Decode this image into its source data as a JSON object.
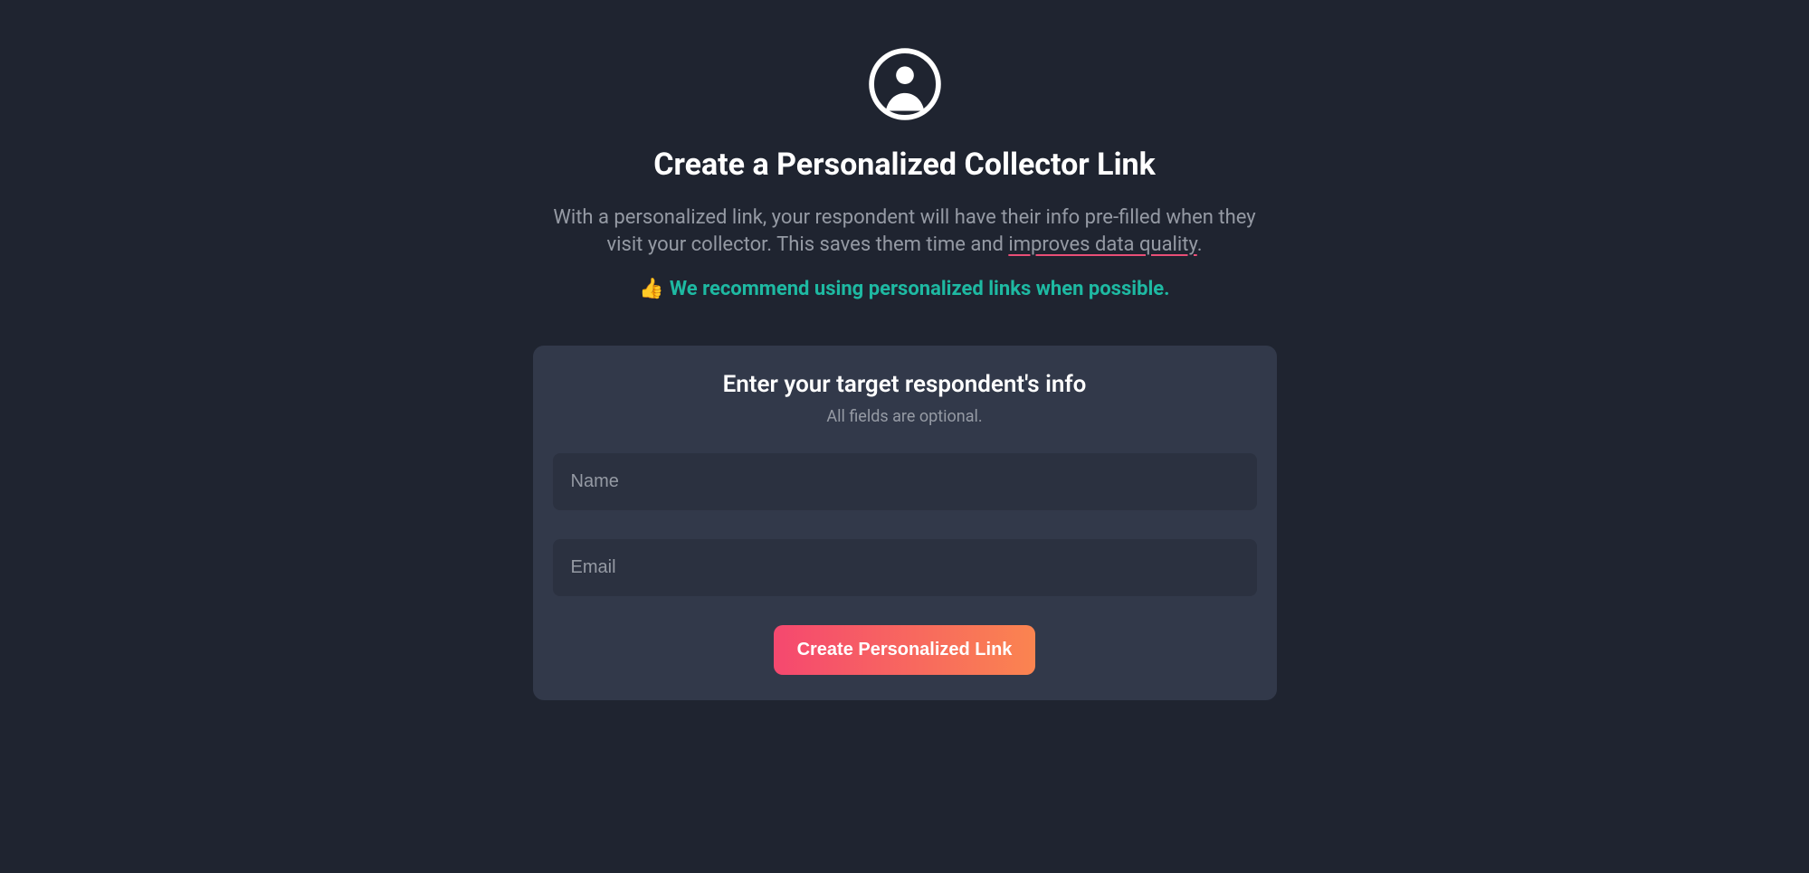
{
  "header": {
    "title": "Create a Personalized Collector Link",
    "description_prefix": "With a personalized link, your respondent will have their info pre-filled when they visit your collector. This saves them time and ",
    "description_underlined": "improves data quality",
    "description_suffix": ".",
    "recommend_emoji": "👍",
    "recommend_text": "We recommend using personalized links when possible."
  },
  "form": {
    "title": "Enter your target respondent's info",
    "subtitle": "All fields are optional.",
    "name_placeholder": "Name",
    "name_value": "",
    "email_placeholder": "Email",
    "email_value": "",
    "submit_label": "Create Personalized Link"
  }
}
